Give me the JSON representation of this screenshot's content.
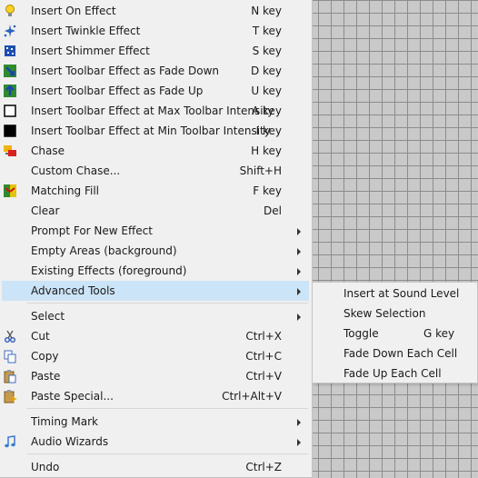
{
  "menu": {
    "items": [
      {
        "label": "Insert On Effect",
        "shortcut": "N key",
        "icon": "lightbulb-icon"
      },
      {
        "label": "Insert Twinkle Effect",
        "shortcut": "T key",
        "icon": "twinkle-icon"
      },
      {
        "label": "Insert Shimmer Effect",
        "shortcut": "S key",
        "icon": "shimmer-icon"
      },
      {
        "label": "Insert Toolbar Effect as Fade Down",
        "shortcut": "D key",
        "icon": "fade-down-icon"
      },
      {
        "label": "Insert Toolbar Effect as Fade Up",
        "shortcut": "U key",
        "icon": "fade-up-icon"
      },
      {
        "label": "Insert Toolbar Effect at Max Toolbar Intensity",
        "shortcut": "A key",
        "icon": "max-intensity-icon"
      },
      {
        "label": "Insert Toolbar Effect at Min Toolbar Intensity",
        "shortcut": "I key",
        "icon": "min-intensity-icon"
      },
      {
        "label": "Chase",
        "shortcut": "H key",
        "icon": "chase-icon"
      },
      {
        "label": "Custom Chase...",
        "shortcut": "Shift+H"
      },
      {
        "label": "Matching Fill",
        "shortcut": "F key",
        "icon": "matching-fill-icon"
      },
      {
        "label": "Clear",
        "shortcut": "Del"
      },
      {
        "label": "Prompt For New Effect",
        "submenu": true
      },
      {
        "label": "Empty Areas (background)",
        "submenu": true
      },
      {
        "label": "Existing Effects (foreground)",
        "submenu": true
      },
      {
        "label": "Advanced Tools",
        "submenu": true,
        "highlighted": true
      },
      {
        "label": "Select",
        "submenu": true
      },
      {
        "label": "Cut",
        "shortcut": "Ctrl+X",
        "icon": "scissors-icon"
      },
      {
        "label": "Copy",
        "shortcut": "Ctrl+C",
        "icon": "copy-icon"
      },
      {
        "label": "Paste",
        "shortcut": "Ctrl+V",
        "icon": "paste-icon"
      },
      {
        "label": "Paste Special...",
        "shortcut": "Ctrl+Alt+V",
        "icon": "paste-special-icon"
      },
      {
        "label": "Timing Mark",
        "submenu": true
      },
      {
        "label": "Audio Wizards",
        "submenu": true,
        "icon": "music-note-icon"
      },
      {
        "label": "Undo",
        "shortcut": "Ctrl+Z"
      }
    ]
  },
  "submenu": {
    "items": [
      {
        "label": "Insert at Sound Level",
        "shortcut": ""
      },
      {
        "label": "Skew Selection",
        "shortcut": ""
      },
      {
        "label": "Toggle",
        "shortcut": "G key"
      },
      {
        "label": "Fade Down Each Cell",
        "shortcut": ""
      },
      {
        "label": "Fade Up Each Cell",
        "shortcut": ""
      }
    ]
  },
  "colors": {
    "menu_background": "#f0f0f0",
    "highlight": "#cce4f7",
    "grid_background": "#c9c9c9",
    "grid_lines": "#8c8c8c"
  }
}
